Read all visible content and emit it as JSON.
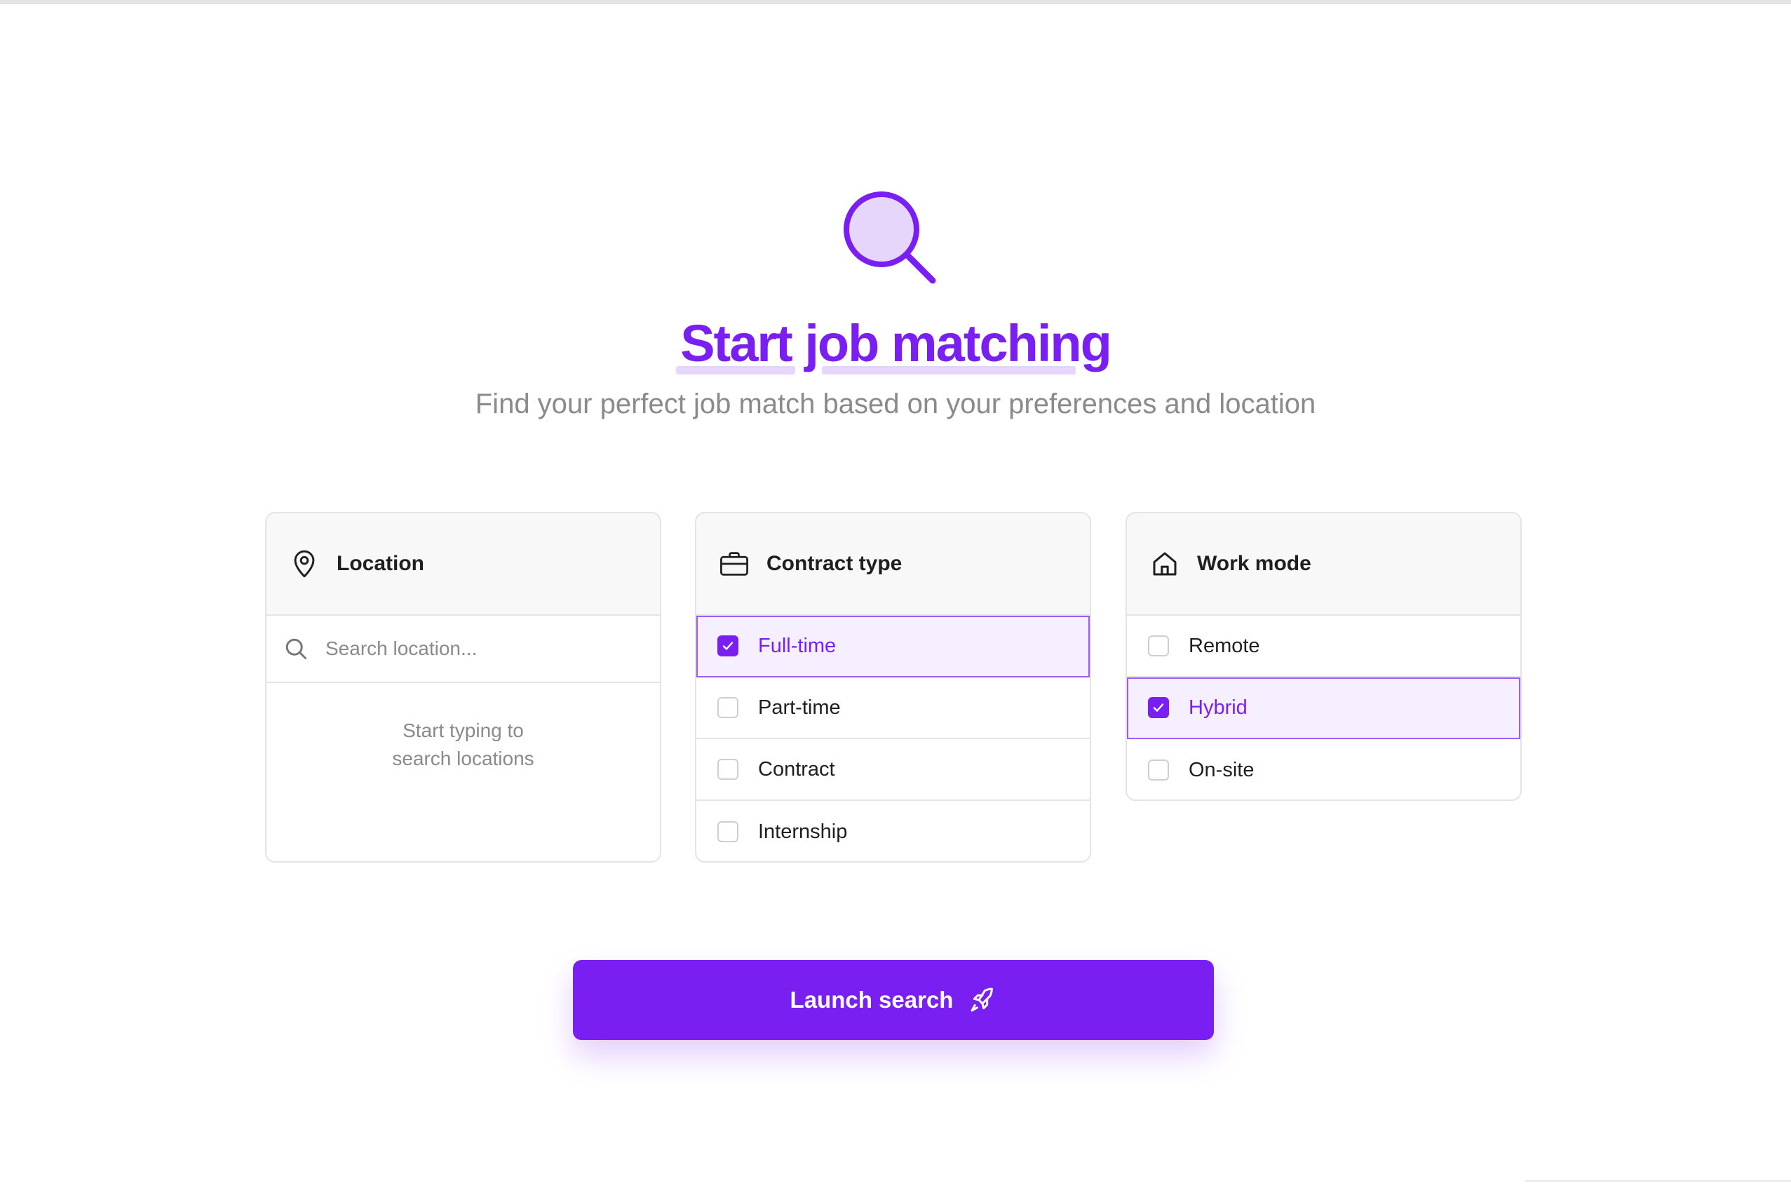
{
  "header": {
    "title": "Start job matching",
    "subtitle": "Find your perfect job match based on your preferences and location",
    "icon": "search-icon"
  },
  "colors": {
    "accent": "#7a1ff2",
    "accent_light": "#e6d6fb",
    "selected_bg": "#f5efff",
    "muted_text": "#8a8a8a"
  },
  "location": {
    "title": "Location",
    "icon": "map-pin-icon",
    "search_placeholder": "Search location...",
    "search_value": "",
    "empty_line1": "Start typing to",
    "empty_line2": "search locations"
  },
  "contract": {
    "title": "Contract type",
    "icon": "briefcase-icon",
    "options": [
      {
        "label": "Full-time",
        "checked": true
      },
      {
        "label": "Part-time",
        "checked": false
      },
      {
        "label": "Contract",
        "checked": false
      },
      {
        "label": "Internship",
        "checked": false
      }
    ]
  },
  "work_mode": {
    "title": "Work mode",
    "icon": "home-icon",
    "options": [
      {
        "label": "Remote",
        "checked": false
      },
      {
        "label": "Hybrid",
        "checked": true
      },
      {
        "label": "On-site",
        "checked": false
      }
    ]
  },
  "actions": {
    "launch_label": "Launch search",
    "launch_icon": "rocket-icon"
  }
}
